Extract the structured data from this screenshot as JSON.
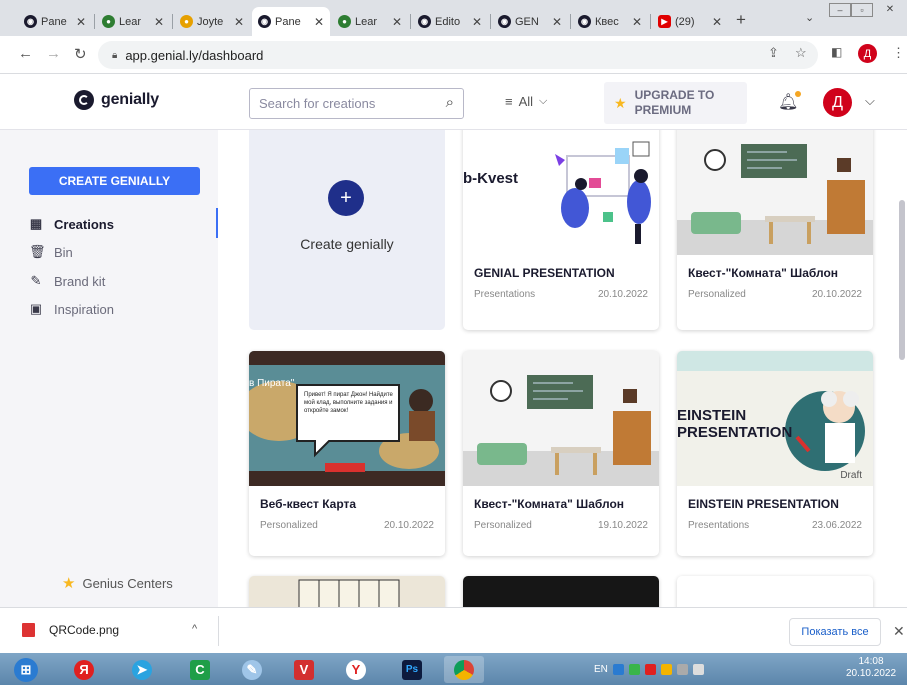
{
  "browser": {
    "tabs": [
      {
        "title": "Pane",
        "color": "#1a1a2e"
      },
      {
        "title": "Lear",
        "color": "#2e7d32"
      },
      {
        "title": "Joyte",
        "color": "#e6a000"
      },
      {
        "title": "Pane",
        "color": "#1a1a2e"
      },
      {
        "title": "Lear",
        "color": "#2e7d32"
      },
      {
        "title": "Edito",
        "color": "#1a1a2e"
      },
      {
        "title": "GEN",
        "color": "#1a1a2e"
      },
      {
        "title": "Квес",
        "color": "#1a1a2e"
      },
      {
        "title": "(29)",
        "color": "#e00000"
      }
    ],
    "close_glyph": "✕",
    "new_tab": "+",
    "url": "app.genial.ly/dashboard",
    "profile_initial": "Д"
  },
  "header": {
    "logo_text": "genially",
    "search_placeholder": "Search for creations",
    "filter_label": "All",
    "upgrade_label": "UPGRADE TO PREMIUM",
    "avatar_initial": "Д"
  },
  "sidebar": {
    "create_button": "CREATE GENIALLY",
    "items": [
      {
        "label": "Creations",
        "icon": "grid-icon",
        "selected": true
      },
      {
        "label": "Bin",
        "icon": "trash-icon",
        "selected": false
      },
      {
        "label": "Brand kit",
        "icon": "brand-kit-icon",
        "selected": false
      },
      {
        "label": "Inspiration",
        "icon": "inspiration-icon",
        "selected": false
      }
    ],
    "genius_label": "Genius Centers"
  },
  "content": {
    "new_card_label": "Create genially",
    "cards": [
      {
        "title": "GENIAL PRESENTATION",
        "meta": "Presentations",
        "date": "20.10.2022",
        "thumb_text": "b-Kvest",
        "theme": "kvest"
      },
      {
        "title": "Квест-\"Комната\" Шаблон",
        "meta": "Personalized",
        "date": "20.10.2022",
        "thumb_text": "",
        "theme": "room"
      },
      {
        "title": "Веб-квест Карта",
        "meta": "Personalized",
        "date": "20.10.2022",
        "thumb_text": "Привет! Я пират Джон! Найдите мой клад, выполните задания и откройте замок!",
        "thumb_label": "в Пирата\"",
        "theme": "pirate"
      },
      {
        "title": "Квест-\"Комната\" Шаблон",
        "meta": "Personalized",
        "date": "19.10.2022",
        "thumb_text": "",
        "theme": "room"
      },
      {
        "title": "EINSTEIN PRESENTATION",
        "meta": "Presentations",
        "date": "23.06.2022",
        "thumb_text": "EINSTEIN PRESENTATION",
        "badge": "Draft",
        "theme": "einstein"
      }
    ]
  },
  "downloads": {
    "file_name": "QRCode.png",
    "show_all": "Показать все"
  },
  "taskbar": {
    "lang": "EN",
    "time": "14:08",
    "date": "20.10.2022",
    "apps": [
      "start",
      "yandex",
      "telegram",
      "classroom",
      "paint",
      "vivaldi",
      "yandex-browser",
      "photoshop",
      "chrome"
    ]
  }
}
